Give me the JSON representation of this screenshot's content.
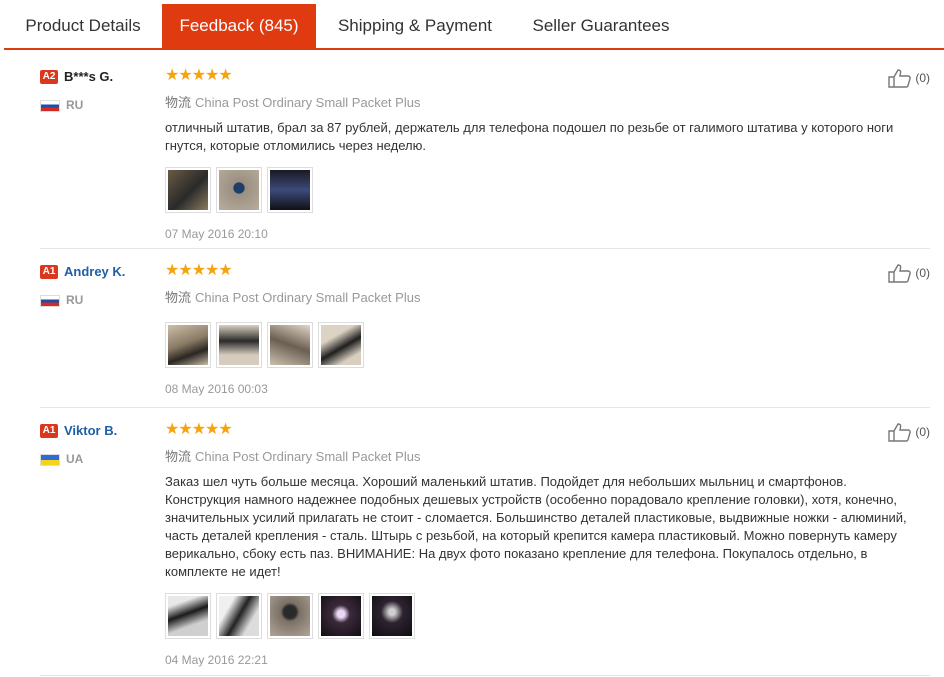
{
  "tabs": [
    {
      "label": "Product Details",
      "active": false
    },
    {
      "label": "Feedback (845)",
      "active": true
    },
    {
      "label": "Shipping & Payment",
      "active": false
    },
    {
      "label": "Seller Guarantees",
      "active": false
    }
  ],
  "colors": {
    "accent": "#e03a10",
    "star": "#f7a30e",
    "link": "#1f5ea8"
  },
  "reviews": [
    {
      "level": "A2",
      "name": "B***s G.",
      "country": "RU",
      "rating": 5,
      "stars": "★★★★★",
      "shipping_cn": "物流",
      "shipping": "China Post Ordinary Small Packet Plus",
      "text": "отличный штатив, брал за 87 рублей, держатель для телефона подошел по резьбе от галимого штатива у которого ноги гнутся, которые отломились через неделю.",
      "photos": 3,
      "date": "07 May 2016 20:10",
      "likes": "(0)"
    },
    {
      "level": "A1",
      "name": "Andrey K.",
      "country": "RU",
      "rating": 5,
      "stars": "★★★★★",
      "shipping_cn": "物流",
      "shipping": "China Post Ordinary Small Packet Plus",
      "text": "",
      "photos": 4,
      "date": "08 May 2016 00:03",
      "likes": "(0)"
    },
    {
      "level": "A1",
      "name": "Viktor B.",
      "country": "UA",
      "rating": 5,
      "stars": "★★★★★",
      "shipping_cn": "物流",
      "shipping": "China Post Ordinary Small Packet Plus",
      "text": "Заказ шел чуть больше месяца. Хороший маленький штатив. Подойдет для небольших мыльниц и смартфонов. Конструкция намного надежнее подобных дешевых устройств (особенно порадовало крепление головки), хотя, конечно, значительных усилий прилагать не стоит - сломается. Большинство деталей пластиковые, выдвижные ножки - алюминий, часть деталей крепления - сталь. Штырь с резьбой, на который крепится камера пластиковый. Можно повернуть камеру верикально, сбоку есть паз. ВНИМАНИЕ: На двух фото показано крепление для телефона. Покупалось отдельно, в комплекте не идет!",
      "photos": 5,
      "date": "04 May 2016 22:21",
      "likes": "(0)"
    }
  ]
}
